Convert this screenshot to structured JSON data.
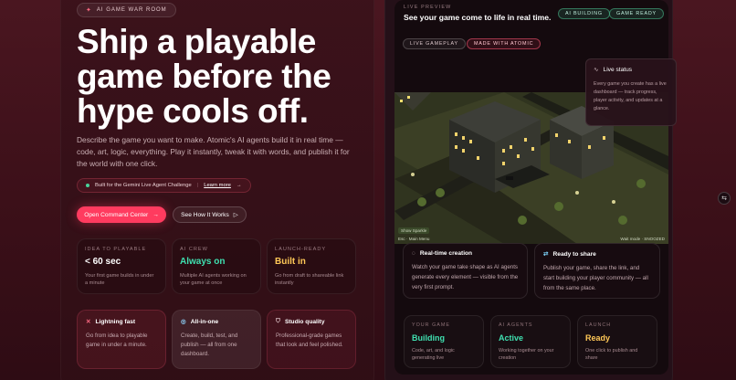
{
  "left": {
    "badge": "AI GAME WAR ROOM",
    "hero": "Ship a playable game before the hype cools off.",
    "description": "Describe the game you want to make. Atomic's AI agents build it in real time — code, art, logic, everything. Play it instantly, tweak it with words, and publish it for the world with one click.",
    "gemini": {
      "text": "Built for the Gemini Live Agent Challenge",
      "separator": "|",
      "link": "Learn more",
      "arrow": "→"
    },
    "primary_button": "Open Command Center",
    "secondary_button": "See How It Works",
    "stats": [
      {
        "key": "IDEA TO PLAYABLE",
        "value": "< 60 sec",
        "sub": "Your first game builds in under a minute",
        "color": "#ffffff"
      },
      {
        "key": "AI CREW",
        "value": "Always on",
        "sub": "Multiple AI agents working on your game at once",
        "color": "#3fe0b0"
      },
      {
        "key": "LAUNCH-READY",
        "value": "Built in",
        "sub": "Go from draft to shareable link instantly",
        "color": "#ffc857"
      }
    ],
    "features": [
      {
        "icon": "sparkle-icon",
        "title": "Lightning fast",
        "desc": "Go from idea to playable game in under a minute."
      },
      {
        "icon": "check-circle-icon",
        "title": "All-in-one",
        "desc": "Create, build, test, and publish — all from one dashboard."
      },
      {
        "icon": "shield-icon",
        "title": "Studio quality",
        "desc": "Professional-grade games that look and feel polished."
      }
    ]
  },
  "right": {
    "label": "LIVE PREVIEW",
    "title": "See your game come to life in real time.",
    "chips": [
      "AI BUILDING",
      "GAME READY"
    ],
    "tabs": [
      "LIVE GAMEPLAY",
      "MADE WITH ATOMIC"
    ],
    "live_status": {
      "title": "Live status",
      "desc": "Every game you create has a live dashboard — track progress, player activity, and updates at a glance."
    },
    "scene_tag": "Show Sparkle",
    "scene_hint": "Esc · Main Menu",
    "scene_right_hint": "Wait mode · SNOOZED",
    "cards": [
      {
        "title": "Real-time creation",
        "desc": "Watch your game take shape as AI agents generate every element — visible from the very first prompt."
      },
      {
        "title": "Ready to share",
        "desc": "Publish your game, share the link, and start building your player community — all from the same place."
      }
    ],
    "stats": [
      {
        "key": "YOUR GAME",
        "value": "Building",
        "sub": "Code, art, and logic generating live",
        "color": "#3fe0b0"
      },
      {
        "key": "AI AGENTS",
        "value": "Active",
        "sub": "Working together on your creation",
        "color": "#3fe0b0"
      },
      {
        "key": "LAUNCH",
        "value": "Ready",
        "sub": "One click to publish and share",
        "color": "#ffc857"
      }
    ]
  }
}
